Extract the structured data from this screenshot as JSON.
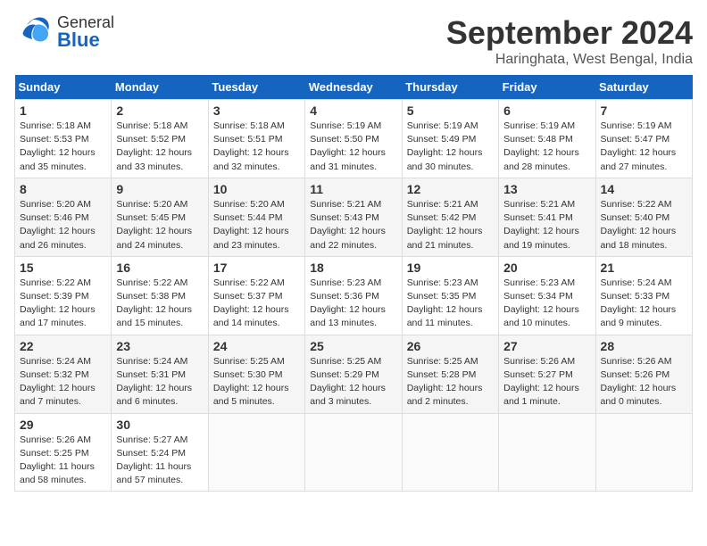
{
  "header": {
    "logo_general": "General",
    "logo_blue": "Blue",
    "month": "September 2024",
    "location": "Haringhata, West Bengal, India"
  },
  "columns": [
    "Sunday",
    "Monday",
    "Tuesday",
    "Wednesday",
    "Thursday",
    "Friday",
    "Saturday"
  ],
  "weeks": [
    [
      {
        "day": "1",
        "info": "Sunrise: 5:18 AM\nSunset: 5:53 PM\nDaylight: 12 hours\nand 35 minutes."
      },
      {
        "day": "2",
        "info": "Sunrise: 5:18 AM\nSunset: 5:52 PM\nDaylight: 12 hours\nand 33 minutes."
      },
      {
        "day": "3",
        "info": "Sunrise: 5:18 AM\nSunset: 5:51 PM\nDaylight: 12 hours\nand 32 minutes."
      },
      {
        "day": "4",
        "info": "Sunrise: 5:19 AM\nSunset: 5:50 PM\nDaylight: 12 hours\nand 31 minutes."
      },
      {
        "day": "5",
        "info": "Sunrise: 5:19 AM\nSunset: 5:49 PM\nDaylight: 12 hours\nand 30 minutes."
      },
      {
        "day": "6",
        "info": "Sunrise: 5:19 AM\nSunset: 5:48 PM\nDaylight: 12 hours\nand 28 minutes."
      },
      {
        "day": "7",
        "info": "Sunrise: 5:19 AM\nSunset: 5:47 PM\nDaylight: 12 hours\nand 27 minutes."
      }
    ],
    [
      {
        "day": "8",
        "info": "Sunrise: 5:20 AM\nSunset: 5:46 PM\nDaylight: 12 hours\nand 26 minutes."
      },
      {
        "day": "9",
        "info": "Sunrise: 5:20 AM\nSunset: 5:45 PM\nDaylight: 12 hours\nand 24 minutes."
      },
      {
        "day": "10",
        "info": "Sunrise: 5:20 AM\nSunset: 5:44 PM\nDaylight: 12 hours\nand 23 minutes."
      },
      {
        "day": "11",
        "info": "Sunrise: 5:21 AM\nSunset: 5:43 PM\nDaylight: 12 hours\nand 22 minutes."
      },
      {
        "day": "12",
        "info": "Sunrise: 5:21 AM\nSunset: 5:42 PM\nDaylight: 12 hours\nand 21 minutes."
      },
      {
        "day": "13",
        "info": "Sunrise: 5:21 AM\nSunset: 5:41 PM\nDaylight: 12 hours\nand 19 minutes."
      },
      {
        "day": "14",
        "info": "Sunrise: 5:22 AM\nSunset: 5:40 PM\nDaylight: 12 hours\nand 18 minutes."
      }
    ],
    [
      {
        "day": "15",
        "info": "Sunrise: 5:22 AM\nSunset: 5:39 PM\nDaylight: 12 hours\nand 17 minutes."
      },
      {
        "day": "16",
        "info": "Sunrise: 5:22 AM\nSunset: 5:38 PM\nDaylight: 12 hours\nand 15 minutes."
      },
      {
        "day": "17",
        "info": "Sunrise: 5:22 AM\nSunset: 5:37 PM\nDaylight: 12 hours\nand 14 minutes."
      },
      {
        "day": "18",
        "info": "Sunrise: 5:23 AM\nSunset: 5:36 PM\nDaylight: 12 hours\nand 13 minutes."
      },
      {
        "day": "19",
        "info": "Sunrise: 5:23 AM\nSunset: 5:35 PM\nDaylight: 12 hours\nand 11 minutes."
      },
      {
        "day": "20",
        "info": "Sunrise: 5:23 AM\nSunset: 5:34 PM\nDaylight: 12 hours\nand 10 minutes."
      },
      {
        "day": "21",
        "info": "Sunrise: 5:24 AM\nSunset: 5:33 PM\nDaylight: 12 hours\nand 9 minutes."
      }
    ],
    [
      {
        "day": "22",
        "info": "Sunrise: 5:24 AM\nSunset: 5:32 PM\nDaylight: 12 hours\nand 7 minutes."
      },
      {
        "day": "23",
        "info": "Sunrise: 5:24 AM\nSunset: 5:31 PM\nDaylight: 12 hours\nand 6 minutes."
      },
      {
        "day": "24",
        "info": "Sunrise: 5:25 AM\nSunset: 5:30 PM\nDaylight: 12 hours\nand 5 minutes."
      },
      {
        "day": "25",
        "info": "Sunrise: 5:25 AM\nSunset: 5:29 PM\nDaylight: 12 hours\nand 3 minutes."
      },
      {
        "day": "26",
        "info": "Sunrise: 5:25 AM\nSunset: 5:28 PM\nDaylight: 12 hours\nand 2 minutes."
      },
      {
        "day": "27",
        "info": "Sunrise: 5:26 AM\nSunset: 5:27 PM\nDaylight: 12 hours\nand 1 minute."
      },
      {
        "day": "28",
        "info": "Sunrise: 5:26 AM\nSunset: 5:26 PM\nDaylight: 12 hours\nand 0 minutes."
      }
    ],
    [
      {
        "day": "29",
        "info": "Sunrise: 5:26 AM\nSunset: 5:25 PM\nDaylight: 11 hours\nand 58 minutes."
      },
      {
        "day": "30",
        "info": "Sunrise: 5:27 AM\nSunset: 5:24 PM\nDaylight: 11 hours\nand 57 minutes."
      },
      {
        "day": "",
        "info": ""
      },
      {
        "day": "",
        "info": ""
      },
      {
        "day": "",
        "info": ""
      },
      {
        "day": "",
        "info": ""
      },
      {
        "day": "",
        "info": ""
      }
    ]
  ]
}
